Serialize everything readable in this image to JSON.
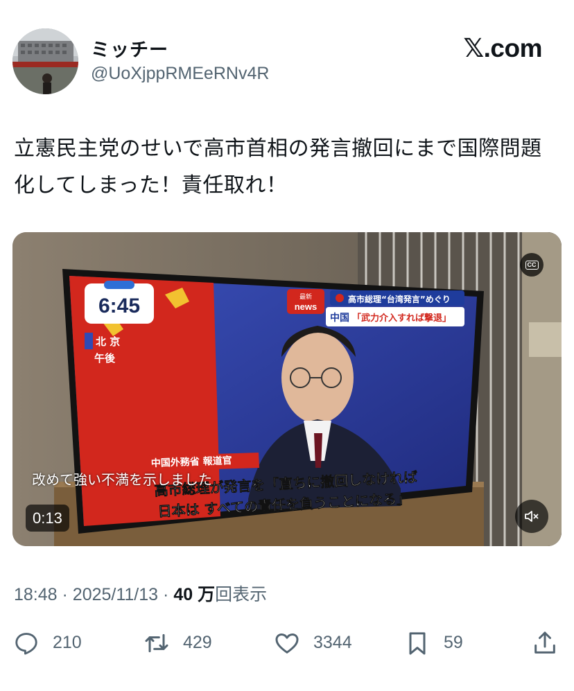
{
  "post": {
    "display_name": "ミッチー",
    "handle": "@UoXjppRMEeRNv4R",
    "brand_x": "𝕏",
    "brand_suffix": ".com",
    "text": "立憲民主党のせいで高市首相の発言撤回にまで国際問題化してしまった！責任取れ！"
  },
  "video": {
    "tv": {
      "clock": "6:45",
      "location_line1": "北 京",
      "location_line2": "午後",
      "news_badge_top": "最新",
      "news_badge_bottom": "news",
      "headline_top": "高市総理“台湾発言”めぐり",
      "headline_prefix": "中国",
      "headline_main": "「武力介入すれば撃退」",
      "speaker_tag": "中国外務省 報道官",
      "subtitle_line1": "高市総理が発言を「直ちに撤回しなければ",
      "subtitle_line2": "日本は すべての責任を負うことになる」"
    },
    "caption": "改めて強い不満を示しました",
    "cc_label": "CC",
    "elapsed": "0:13",
    "mute_icon": "speaker-muted-icon"
  },
  "meta": {
    "time": "18:48",
    "date": "2025/11/13",
    "sep": "·",
    "views": "40 万",
    "views_label": "回表示"
  },
  "actions": {
    "replies": "210",
    "reposts": "429",
    "likes": "3344",
    "bookmarks": "59"
  },
  "colors": {
    "text_primary": "#0f1419",
    "text_secondary": "#536471",
    "tv_red": "#d2271d",
    "tv_blue": "#2e3ea3"
  }
}
